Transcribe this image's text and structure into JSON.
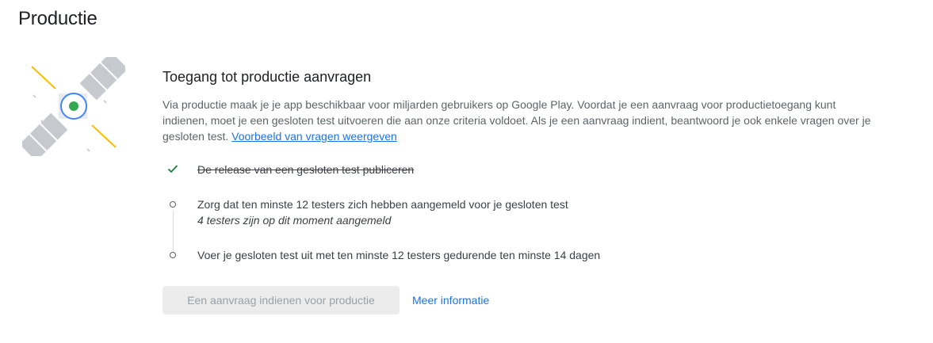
{
  "page": {
    "title": "Productie"
  },
  "section": {
    "title": "Toegang tot productie aanvragen",
    "description": "Via productie maak je je app beschikbaar voor miljarden gebruikers op Google Play. Voordat je een aanvraag voor productietoegang kunt indienen, moet je een gesloten test uitvoeren die aan onze criteria voldoet. Als je een aanvraag indient, beantwoord je ook enkele vragen over je gesloten test.",
    "description_link": "Voorbeeld van vragen weergeven"
  },
  "steps": [
    {
      "label": "De release van een gesloten test publiceren",
      "status": "done"
    },
    {
      "label": "Zorg dat ten minste 12 testers zich hebben aangemeld voor je gesloten test",
      "sublabel": "4 testers zijn op dit moment aangemeld",
      "status": "pending"
    },
    {
      "label": "Voer je gesloten test uit met ten minste 12 testers gedurende ten minste 14 dagen",
      "status": "pending"
    }
  ],
  "actions": {
    "apply_button": "Een aanvraag indienen voor productie",
    "apply_enabled": false,
    "more_info_link": "Meer informatie"
  },
  "colors": {
    "accent": "#1a73e8",
    "success": "#188038",
    "satellite_dot": "#34a853",
    "illustration_lines": "#fbbc04"
  },
  "icons": {
    "illustration": "satellite-illustration",
    "done": "check-icon",
    "pending": "circle-step-icon"
  }
}
